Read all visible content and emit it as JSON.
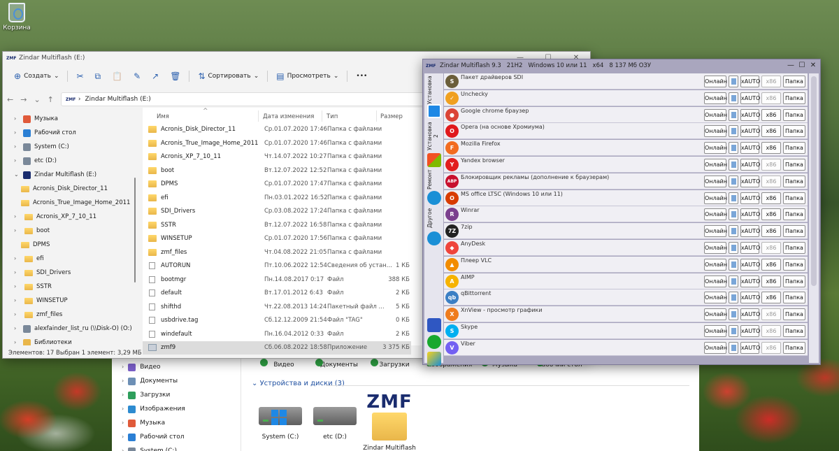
{
  "desktop": {
    "recycle_label": "Корзина"
  },
  "background_explorer": {
    "nav": [
      {
        "label": "Видео",
        "color": "#7b5fc9"
      },
      {
        "label": "Документы",
        "color": "#6d8fb5"
      },
      {
        "label": "Загрузки",
        "color": "#2e9e5b"
      },
      {
        "label": "Изображения",
        "color": "#2d8bd0"
      },
      {
        "label": "Музыка",
        "color": "#e05a3a"
      },
      {
        "label": "Рабочий стол",
        "color": "#2b7fd4"
      },
      {
        "label": "System (C:)",
        "color": "#7a8899"
      }
    ],
    "libraries": [
      "Видео",
      "Документы",
      "Загрузки",
      "Изображения",
      "Музыка",
      "Рабочий стол"
    ],
    "section_title": "Устройства и диски (3)",
    "drives": [
      {
        "label": "System (C:)"
      },
      {
        "label": "etc (D:)"
      },
      {
        "label": "Zindar Multiflash (E:)",
        "logo": "ZMF"
      }
    ]
  },
  "explorer": {
    "title": "Zindar Multiflash (E:)",
    "logo": "ZMF",
    "controls": [
      "—",
      "☐",
      "✕"
    ],
    "toolbar": {
      "create": "Создать",
      "cut": "✂",
      "copy": "⧉",
      "paste": "📋",
      "rename": "✎",
      "share": "↗",
      "delete": "🗑",
      "sort": "Сортировать",
      "view": "Просмотреть",
      "more": "•••"
    },
    "address": {
      "back": "←",
      "forward": "→",
      "down": "⌄",
      "up": "↑",
      "sep": "›",
      "path": "Zindar Multiflash (E:)"
    },
    "nav_tree": [
      {
        "label": "Музыка",
        "indent": 0,
        "chev": "›",
        "icon_color": "#e05a3a"
      },
      {
        "label": "Рабочий стол",
        "indent": 0,
        "chev": "›",
        "icon_color": "#2b7fd4"
      },
      {
        "label": "System (C:)",
        "indent": 0,
        "chev": "›",
        "icon_color": "#7a8899"
      },
      {
        "label": "etc (D:)",
        "indent": 0,
        "chev": "›",
        "icon_color": "#7a8899"
      },
      {
        "label": "Zindar Multiflash (E:)",
        "indent": 0,
        "chev": "⌄",
        "icon_color": "#1a2c6e"
      },
      {
        "label": "Acronis_Disk_Director_11",
        "indent": 1,
        "chev": "",
        "icon_color": ""
      },
      {
        "label": "Acronis_True_Image_Home_2011",
        "indent": 1,
        "chev": "",
        "icon_color": ""
      },
      {
        "label": "Acronis_XP_7_10_11",
        "indent": 1,
        "chev": "›",
        "icon_color": ""
      },
      {
        "label": "boot",
        "indent": 1,
        "chev": "›",
        "icon_color": ""
      },
      {
        "label": "DPMS",
        "indent": 1,
        "chev": "",
        "icon_color": ""
      },
      {
        "label": "efi",
        "indent": 1,
        "chev": "›",
        "icon_color": ""
      },
      {
        "label": "SDI_Drivers",
        "indent": 1,
        "chev": "›",
        "icon_color": ""
      },
      {
        "label": "SSTR",
        "indent": 1,
        "chev": "›",
        "icon_color": ""
      },
      {
        "label": "WINSETUP",
        "indent": 1,
        "chev": "›",
        "icon_color": ""
      },
      {
        "label": "zmf_files",
        "indent": 1,
        "chev": "›",
        "icon_color": ""
      },
      {
        "label": "alexfainder_list_ru (\\\\Disk-O) (O:)",
        "indent": 0,
        "chev": "›",
        "icon_color": "#7a8899"
      },
      {
        "label": "Библиотеки",
        "indent": 0,
        "chev": "›",
        "icon_color": "#e9b64a"
      }
    ],
    "columns": {
      "name": "Имя",
      "date": "Дата изменения",
      "type": "Тип",
      "size": "Размер",
      "sort_indicator": "^"
    },
    "files": [
      {
        "icon": "folder",
        "name": "Acronis_Disk_Director_11",
        "date": "Ср.01.07.2020 17:46",
        "type": "Папка с файлами",
        "size": ""
      },
      {
        "icon": "folder",
        "name": "Acronis_True_Image_Home_2011",
        "date": "Ср.01.07.2020 17:46",
        "type": "Папка с файлами",
        "size": ""
      },
      {
        "icon": "folder",
        "name": "Acronis_XP_7_10_11",
        "date": "Чт.14.07.2022 10:27",
        "type": "Папка с файлами",
        "size": ""
      },
      {
        "icon": "folder",
        "name": "boot",
        "date": "Вт.12.07.2022 12:52",
        "type": "Папка с файлами",
        "size": ""
      },
      {
        "icon": "folder",
        "name": "DPMS",
        "date": "Ср.01.07.2020 17:47",
        "type": "Папка с файлами",
        "size": ""
      },
      {
        "icon": "folder",
        "name": "efi",
        "date": "Пн.03.01.2022 16:52",
        "type": "Папка с файлами",
        "size": ""
      },
      {
        "icon": "folder",
        "name": "SDI_Drivers",
        "date": "Ср.03.08.2022 17:24",
        "type": "Папка с файлами",
        "size": ""
      },
      {
        "icon": "folder",
        "name": "SSTR",
        "date": "Вт.12.07.2022 16:58",
        "type": "Папка с файлами",
        "size": ""
      },
      {
        "icon": "folder",
        "name": "WINSETUP",
        "date": "Ср.01.07.2020 17:56",
        "type": "Папка с файлами",
        "size": ""
      },
      {
        "icon": "folder",
        "name": "zmf_files",
        "date": "Чт.04.08.2022 21:05",
        "type": "Папка с файлами",
        "size": ""
      },
      {
        "icon": "file",
        "name": "AUTORUN",
        "date": "Пт.10.06.2022 12:54",
        "type": "Сведения об устан...",
        "size": "1 КБ"
      },
      {
        "icon": "file",
        "name": "bootmgr",
        "date": "Пн.14.08.2017 0:17",
        "type": "Файл",
        "size": "388 КБ"
      },
      {
        "icon": "file",
        "name": "default",
        "date": "Вт.17.01.2012 6:43",
        "type": "Файл",
        "size": "2 КБ"
      },
      {
        "icon": "file",
        "name": "shifthd",
        "date": "Чт.22.08.2013 14:24",
        "type": "Пакетный файл ...",
        "size": "5 КБ"
      },
      {
        "icon": "file",
        "name": "usbdrive.tag",
        "date": "Сб.12.12.2009 21:54",
        "type": "Файл \"TAG\"",
        "size": "0 КБ"
      },
      {
        "icon": "file",
        "name": "windefault",
        "date": "Пн.16.04.2012 0:33",
        "type": "Файл",
        "size": "2 КБ"
      },
      {
        "icon": "app",
        "name": "zmf9",
        "date": "Сб.06.08.2022 18:58",
        "type": "Приложение",
        "size": "3 375 КБ",
        "selected": true
      }
    ],
    "status": "Элементов: 17    Выбран 1 элемент: 3,29 МБ"
  },
  "zmf": {
    "title_parts": [
      "Zindar Multiflash 9.3",
      "21H2",
      "Windows 10 или 11",
      "x64",
      "8 137 Мб ОЗУ"
    ],
    "controls": [
      "—",
      "☐",
      "✕"
    ],
    "tabs": [
      "Установка",
      "Установка 2",
      "Ремонт",
      "Другое"
    ],
    "btn_labels": {
      "online": "Онлайн",
      "auto": "xAUTO",
      "x86": "x86",
      "folder": "Папка"
    },
    "apps": [
      {
        "name": "Пакет драйверов SDI",
        "glyph": "S",
        "color": "#6b5e3a",
        "x86": false
      },
      {
        "name": "Unchecky",
        "glyph": "✓",
        "color": "#f0a020",
        "x86": false
      },
      {
        "name": "Google chrome браузер",
        "glyph": "●",
        "color": "#db4437",
        "x86": true
      },
      {
        "name": "Opera (на основе Хромиума)",
        "glyph": "O",
        "color": "#e0181c",
        "x86": true
      },
      {
        "name": "Mozilla Firefox",
        "glyph": "F",
        "color": "#f26b20",
        "x86": true
      },
      {
        "name": "Yandex browser",
        "glyph": "Y",
        "color": "#e21e1e",
        "x86": false
      },
      {
        "name": "Блокировщик рекламы (дополнение к браузерам)",
        "glyph": "ABP",
        "color": "#c8102e",
        "x86": false
      },
      {
        "name": "MS office LTSC (Windows 10 или 11)",
        "glyph": "O",
        "color": "#d83b01",
        "x86": true
      },
      {
        "name": "Winrar",
        "glyph": "R",
        "color": "#7b3f8e",
        "x86": true
      },
      {
        "name": "7zip",
        "glyph": "7Z",
        "color": "#222222",
        "x86": true
      },
      {
        "name": "AnyDesk",
        "glyph": "◆",
        "color": "#ef443b",
        "x86": false
      },
      {
        "name": "Плеер VLC",
        "glyph": "▲",
        "color": "#f28c00",
        "x86": true
      },
      {
        "name": "AIMP",
        "glyph": "A",
        "color": "#f6b300",
        "x86": true
      },
      {
        "name": "qBittorrent",
        "glyph": "qb",
        "color": "#3b7fc4",
        "x86": true
      },
      {
        "name": "XnView - просмотр графики",
        "glyph": "X",
        "color": "#ef7c1d",
        "x86": false
      },
      {
        "name": "Skype",
        "glyph": "S",
        "color": "#00aff0",
        "x86": false
      },
      {
        "name": "Viber",
        "glyph": "V",
        "color": "#7360f2",
        "x86": false
      }
    ]
  }
}
